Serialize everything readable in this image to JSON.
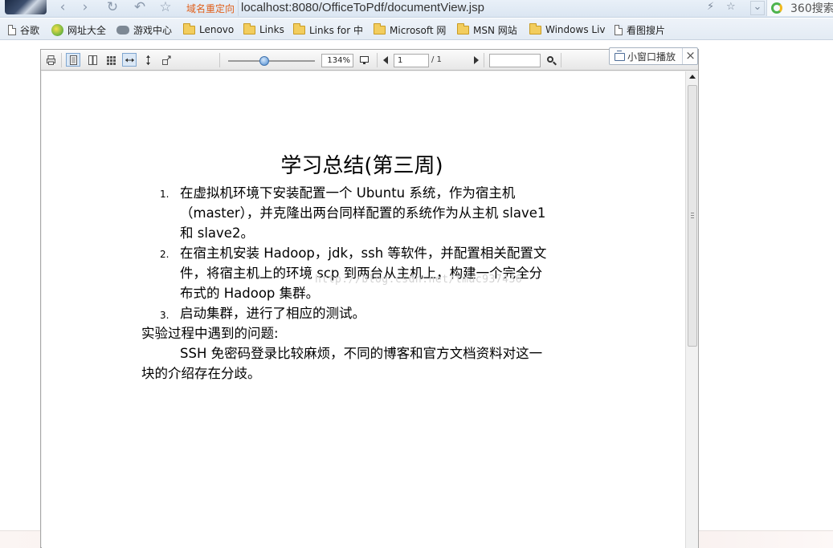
{
  "browser": {
    "redirect_label": "域名重定向",
    "address": "localhost:8080/OfficeToPdf/documentView.jsp",
    "search_label": "360搜索",
    "nav": {
      "back": "‹",
      "forward": "›",
      "reload": "↻",
      "undo": "↶",
      "favorite": "☆",
      "lightning": "⚡",
      "star": "☆",
      "menu": "⌄"
    }
  },
  "bookmarks": [
    {
      "label": "谷歌",
      "icon": "page-icon"
    },
    {
      "label": "网址大全",
      "icon": "globe-icon"
    },
    {
      "label": "游戏中心",
      "icon": "gamepad-icon"
    },
    {
      "label": "Lenovo",
      "icon": "folder-icon"
    },
    {
      "label": "Links",
      "icon": "folder-icon"
    },
    {
      "label": "Links for 中",
      "icon": "folder-icon"
    },
    {
      "label": "Microsoft 网",
      "icon": "folder-icon"
    },
    {
      "label": "MSN 网站",
      "icon": "folder-icon"
    },
    {
      "label": "Windows Liv",
      "icon": "folder-icon"
    },
    {
      "label": "看图搜片",
      "icon": "page-icon"
    }
  ],
  "mini_player": {
    "label": "小窗口播放",
    "close": "×"
  },
  "viewer": {
    "zoom": "134%",
    "current_page": "1",
    "page_count": "/ 1",
    "search_value": ""
  },
  "document": {
    "title": "学习总结(第三周)",
    "items": [
      {
        "number": "1.",
        "lines": [
          "在虚拟机环境下安装配置一个 Ubuntu 系统，作为宿主机",
          "（master），并克隆出两台同样配置的系统作为从主机 slave1",
          "和 slave2。"
        ]
      },
      {
        "number": "2.",
        "lines": [
          "在宿主机安装 Hadoop，jdk，ssh 等软件，并配置相关配置文",
          "件，将宿主机上的环境 scp 到两台从主机上，构建一个完全分",
          "布式的 Hadoop 集群。"
        ]
      },
      {
        "number": "3.",
        "lines": [
          "启动集群，进行了相应的测试。"
        ]
      }
    ],
    "problems_heading": "实验过程中遇到的问题:",
    "problems_lines": [
      "SSH 免密码登录比较麻烦，不同的博客和官方文档资料对这一",
      "块的介绍存在分歧。"
    ],
    "watermark": "http://blog.csdn.net/tmac937436"
  }
}
